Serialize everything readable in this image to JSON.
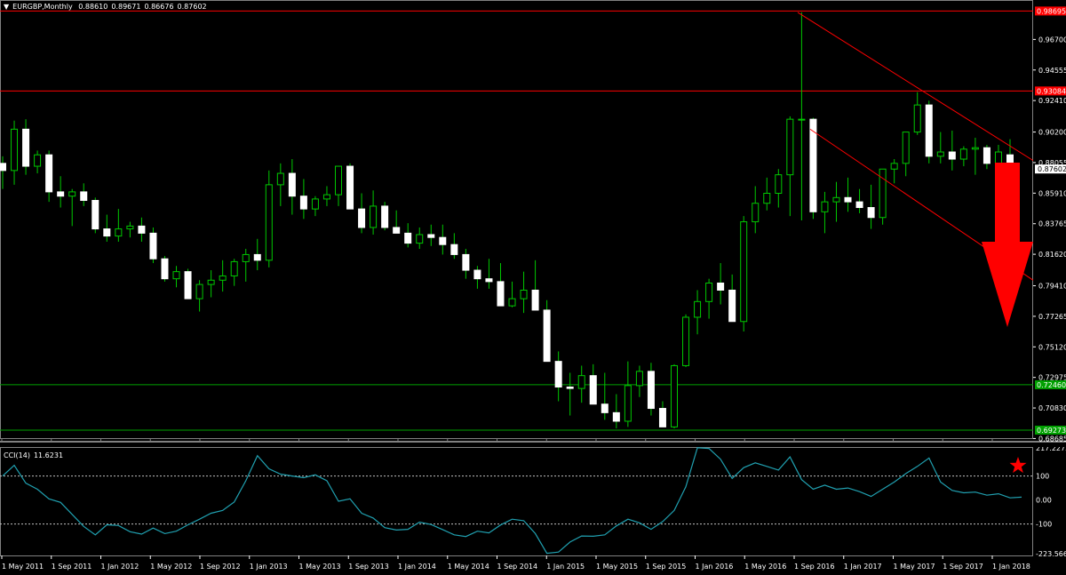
{
  "header": {
    "symbol": "EURGBP,Monthly",
    "open": "0.88610",
    "high": "0.89671",
    "low": "0.86676",
    "close": "0.87602"
  },
  "cci_header": {
    "name": "CCI(14)",
    "value": "11.6231"
  },
  "colors": {
    "background": "#000000",
    "bull_candle_body": "#000000",
    "bull_candle_border": "#00c800",
    "bear_candle_body": "#ffffff",
    "wick": "#00c800",
    "resistance_line": "#ff0000",
    "support_line": "#00a000",
    "cci_line": "#20a0b0",
    "arrow": "#ff0000",
    "star": "#ff0000"
  },
  "chart_data": [
    {
      "type": "candlestick",
      "title": "EURGBP,Monthly",
      "y_range": [
        0.6865,
        0.9872
      ],
      "price_ticks": [
        "0.96700",
        "0.94555",
        "0.92410",
        "0.90200",
        "0.88055",
        "0.85910",
        "0.83765",
        "0.81620",
        "0.79410",
        "0.77265",
        "0.75120",
        "0.72975",
        "0.70830",
        "0.68685"
      ],
      "level_labels": [
        {
          "value": "0.98695",
          "color": "#ff0000"
        },
        {
          "value": "0.93084",
          "color": "#ff0000"
        },
        {
          "value": "0.72460",
          "color": "#00a000"
        },
        {
          "value": "0.69273",
          "color": "#00a000"
        }
      ],
      "current_price": "0.87602",
      "x_ticks": [
        "1 May 2011",
        "1 Sep 2011",
        "1 Jan 2012",
        "1 May 2012",
        "1 Sep 2012",
        "1 Jan 2013",
        "1 May 2013",
        "1 Sep 2013",
        "1 Jan 2014",
        "1 May 2014",
        "1 Sep 2014",
        "1 Jan 2015",
        "1 May 2015",
        "1 Sep 2015",
        "1 Jan 2016",
        "1 May 2016",
        "1 Sep 2016",
        "1 Jan 2017",
        "1 May 2017",
        "1 Sep 2017",
        "1 Jan 2018"
      ],
      "candles": [
        [
          0.88,
          0.885,
          0.862,
          0.875
        ],
        [
          0.875,
          0.91,
          0.865,
          0.904
        ],
        [
          0.904,
          0.911,
          0.872,
          0.878
        ],
        [
          0.878,
          0.889,
          0.873,
          0.886
        ],
        [
          0.886,
          0.889,
          0.853,
          0.86
        ],
        [
          0.86,
          0.871,
          0.849,
          0.857
        ],
        [
          0.857,
          0.862,
          0.836,
          0.86
        ],
        [
          0.86,
          0.866,
          0.85,
          0.854
        ],
        [
          0.854,
          0.856,
          0.831,
          0.834
        ],
        [
          0.834,
          0.844,
          0.825,
          0.829
        ],
        [
          0.829,
          0.848,
          0.825,
          0.834
        ],
        [
          0.834,
          0.839,
          0.828,
          0.836
        ],
        [
          0.836,
          0.842,
          0.825,
          0.831
        ],
        [
          0.831,
          0.835,
          0.81,
          0.813
        ],
        [
          0.813,
          0.815,
          0.797,
          0.799
        ],
        [
          0.799,
          0.808,
          0.793,
          0.804
        ],
        [
          0.804,
          0.806,
          0.786,
          0.785
        ],
        [
          0.785,
          0.798,
          0.776,
          0.795
        ],
        [
          0.795,
          0.805,
          0.786,
          0.798
        ],
        [
          0.798,
          0.812,
          0.79,
          0.801
        ],
        [
          0.801,
          0.813,
          0.794,
          0.811
        ],
        [
          0.811,
          0.82,
          0.797,
          0.816
        ],
        [
          0.816,
          0.827,
          0.805,
          0.812
        ],
        [
          0.812,
          0.875,
          0.807,
          0.865
        ],
        [
          0.865,
          0.88,
          0.85,
          0.873
        ],
        [
          0.873,
          0.883,
          0.844,
          0.857
        ],
        [
          0.857,
          0.869,
          0.841,
          0.848
        ],
        [
          0.848,
          0.857,
          0.843,
          0.855
        ],
        [
          0.855,
          0.864,
          0.85,
          0.858
        ],
        [
          0.858,
          0.875,
          0.85,
          0.878
        ],
        [
          0.878,
          0.88,
          0.848,
          0.848
        ],
        [
          0.848,
          0.859,
          0.831,
          0.835
        ],
        [
          0.835,
          0.861,
          0.83,
          0.85
        ],
        [
          0.85,
          0.853,
          0.833,
          0.835
        ],
        [
          0.835,
          0.847,
          0.833,
          0.831
        ],
        [
          0.831,
          0.838,
          0.821,
          0.824
        ],
        [
          0.824,
          0.835,
          0.82,
          0.83
        ],
        [
          0.83,
          0.837,
          0.822,
          0.828
        ],
        [
          0.828,
          0.837,
          0.816,
          0.823
        ],
        [
          0.823,
          0.831,
          0.813,
          0.816
        ],
        [
          0.816,
          0.82,
          0.799,
          0.805
        ],
        [
          0.805,
          0.808,
          0.792,
          0.799
        ],
        [
          0.799,
          0.813,
          0.792,
          0.797
        ],
        [
          0.797,
          0.81,
          0.784,
          0.78
        ],
        [
          0.78,
          0.797,
          0.779,
          0.785
        ],
        [
          0.785,
          0.804,
          0.775,
          0.791
        ],
        [
          0.791,
          0.812,
          0.78,
          0.777
        ],
        [
          0.777,
          0.784,
          0.743,
          0.741
        ],
        [
          0.741,
          0.748,
          0.713,
          0.723
        ],
        [
          0.723,
          0.733,
          0.703,
          0.722
        ],
        [
          0.722,
          0.738,
          0.712,
          0.731
        ],
        [
          0.731,
          0.739,
          0.713,
          0.711
        ],
        [
          0.711,
          0.733,
          0.7,
          0.705
        ],
        [
          0.705,
          0.718,
          0.694,
          0.699
        ],
        [
          0.699,
          0.741,
          0.695,
          0.724
        ],
        [
          0.724,
          0.738,
          0.716,
          0.734
        ],
        [
          0.734,
          0.74,
          0.703,
          0.708
        ],
        [
          0.708,
          0.713,
          0.695,
          0.695
        ],
        [
          0.695,
          0.739,
          0.694,
          0.738
        ],
        [
          0.738,
          0.774,
          0.737,
          0.772
        ],
        [
          0.772,
          0.791,
          0.76,
          0.783
        ],
        [
          0.783,
          0.799,
          0.771,
          0.796
        ],
        [
          0.796,
          0.81,
          0.781,
          0.791
        ],
        [
          0.791,
          0.802,
          0.78,
          0.769
        ],
        [
          0.769,
          0.843,
          0.762,
          0.839
        ],
        [
          0.839,
          0.864,
          0.831,
          0.852
        ],
        [
          0.852,
          0.87,
          0.847,
          0.859
        ],
        [
          0.859,
          0.876,
          0.849,
          0.872
        ],
        [
          0.872,
          0.913,
          0.843,
          0.911
        ],
        [
          0.911,
          0.986,
          0.84,
          0.911
        ],
        [
          0.911,
          0.912,
          0.841,
          0.846
        ],
        [
          0.846,
          0.86,
          0.831,
          0.853
        ],
        [
          0.853,
          0.867,
          0.839,
          0.856
        ],
        [
          0.856,
          0.87,
          0.846,
          0.853
        ],
        [
          0.853,
          0.862,
          0.845,
          0.849
        ],
        [
          0.849,
          0.865,
          0.834,
          0.842
        ],
        [
          0.842,
          0.875,
          0.837,
          0.876
        ],
        [
          0.876,
          0.883,
          0.866,
          0.88
        ],
        [
          0.88,
          0.896,
          0.871,
          0.902
        ],
        [
          0.902,
          0.93,
          0.9,
          0.921
        ],
        [
          0.921,
          0.924,
          0.88,
          0.885
        ],
        [
          0.885,
          0.902,
          0.88,
          0.888
        ],
        [
          0.888,
          0.903,
          0.875,
          0.883
        ],
        [
          0.883,
          0.892,
          0.878,
          0.89
        ],
        [
          0.89,
          0.898,
          0.872,
          0.891
        ],
        [
          0.891,
          0.893,
          0.876,
          0.88
        ],
        [
          0.88,
          0.893,
          0.876,
          0.888
        ],
        [
          0.886,
          0.897,
          0.867,
          0.876
        ]
      ]
    },
    {
      "type": "line",
      "title": "CCI(14) 11.6231",
      "ylim": [
        -223.5661,
        217.2273
      ],
      "y_ticks": [
        "217.2273",
        "100",
        "0.00",
        "-100",
        "-223.5661"
      ],
      "dashed_levels": [
        100,
        -100
      ],
      "values": [
        100,
        145,
        70,
        45,
        5,
        -10,
        -60,
        -110,
        -145,
        -103,
        -106,
        -132,
        -142,
        -117,
        -140,
        -130,
        -103,
        -80,
        -55,
        -43,
        -8,
        80,
        185,
        130,
        108,
        100,
        93,
        105,
        80,
        -5,
        5,
        -55,
        -75,
        -115,
        -125,
        -122,
        -92,
        -102,
        -123,
        -145,
        -152,
        -130,
        -137,
        -104,
        -80,
        -86,
        -140,
        -222,
        -217,
        -175,
        -150,
        -151,
        -145,
        -108,
        -80,
        -95,
        -122,
        -90,
        -43,
        55,
        218,
        215,
        170,
        90,
        135,
        155,
        140,
        125,
        180,
        85,
        45,
        62,
        45,
        50,
        35,
        15,
        45,
        75,
        110,
        140,
        175,
        75,
        40,
        30,
        33,
        20,
        26,
        9,
        12
      ]
    }
  ],
  "annotations": {
    "arrow": "down-arrow",
    "star": "star"
  }
}
